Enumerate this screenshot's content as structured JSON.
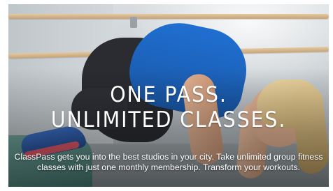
{
  "hero": {
    "image_description": "woman-in-blue-top-doing-crow-pose",
    "headline_line1": "ONE PASS.",
    "headline_line2": "UNLIMITED CLASSES.",
    "body": "ClassPass gets you into the best studios in your city. Take unlimited group fitness classes with just one monthly membership. Transform your workouts."
  },
  "colors": {
    "headline": "#ffffff",
    "body_text": "#ffffff",
    "top": "#1f6fd1"
  }
}
